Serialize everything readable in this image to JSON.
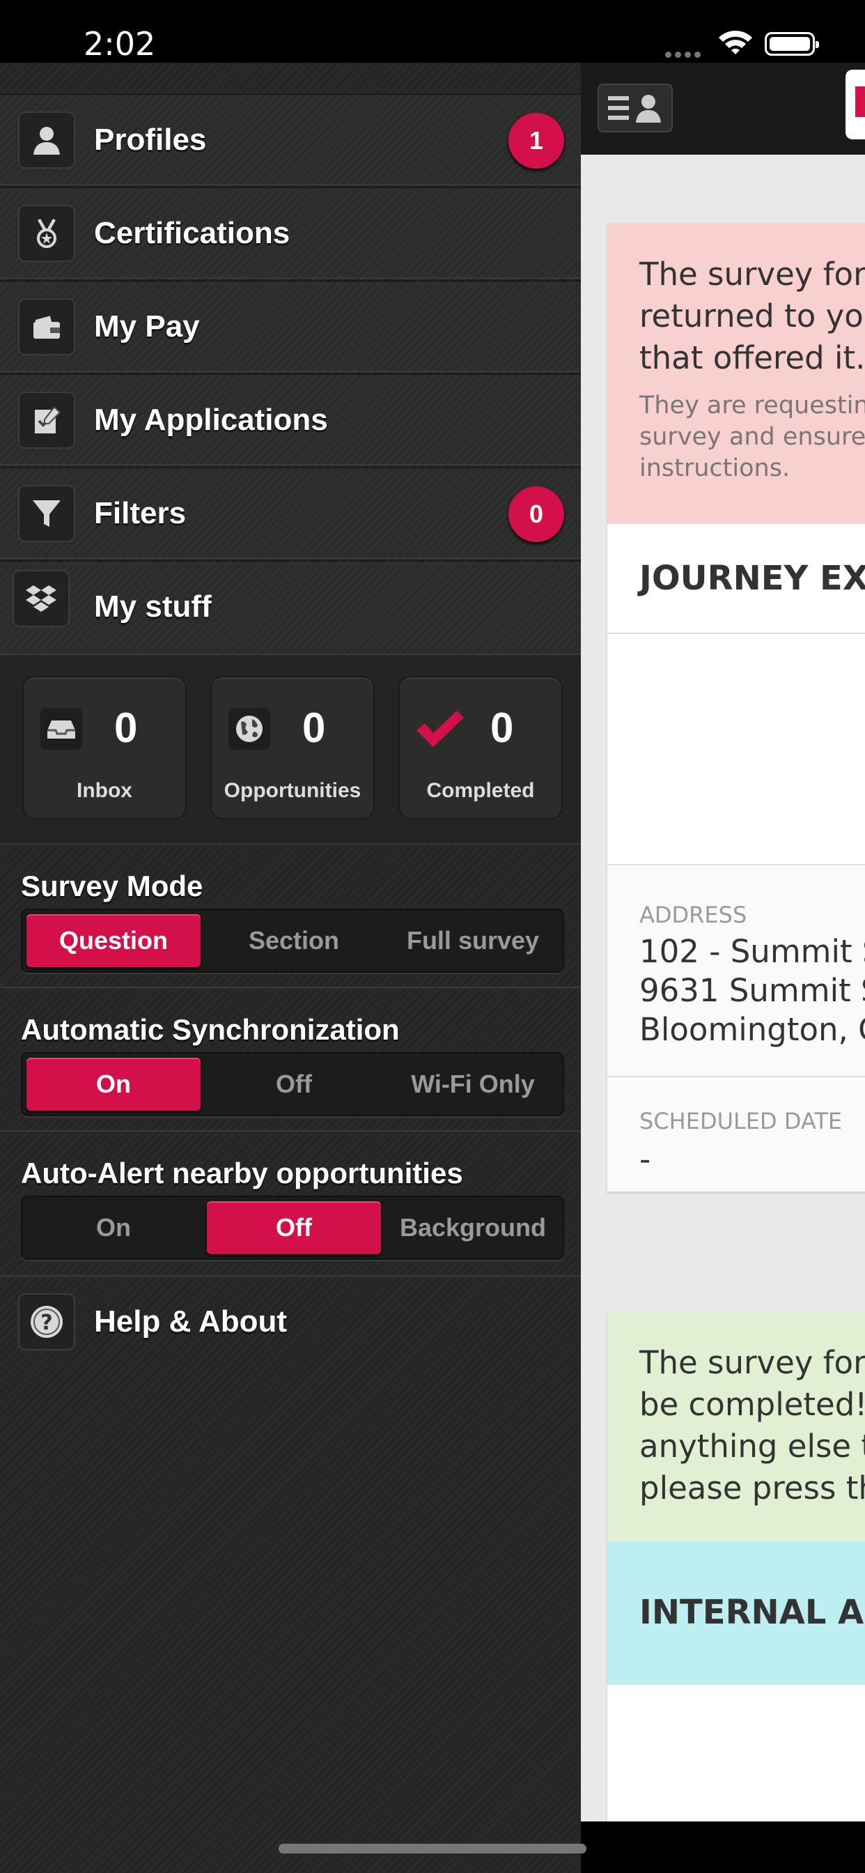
{
  "status_bar": {
    "time": "2:02"
  },
  "sidebar": {
    "items": [
      {
        "label": "Profiles",
        "badge": "1",
        "icon": "person-icon"
      },
      {
        "label": "Certifications",
        "badge": null,
        "icon": "medal-icon"
      },
      {
        "label": "My Pay",
        "badge": null,
        "icon": "wallet-icon"
      },
      {
        "label": "My Applications",
        "badge": null,
        "icon": "application-icon"
      },
      {
        "label": "Filters",
        "badge": "0",
        "icon": "filter-icon"
      },
      {
        "label": "My stuff",
        "badge": null,
        "icon": "dropbox-icon"
      }
    ],
    "stuff": [
      {
        "count": "0",
        "label": "Inbox",
        "icon": "inbox-icon"
      },
      {
        "count": "0",
        "label": "Opportunities",
        "icon": "globe-icon"
      },
      {
        "count": "0",
        "label": "Completed",
        "icon": "checkmark-icon"
      }
    ],
    "survey_mode": {
      "title": "Survey Mode",
      "options": [
        "Question",
        "Section",
        "Full survey"
      ],
      "selected": "Question"
    },
    "auto_sync": {
      "title": "Automatic Synchronization",
      "options": [
        "On",
        "Off",
        "Wi-Fi Only"
      ],
      "selected": "On"
    },
    "auto_alert": {
      "title": "Auto-Alert nearby opportunities",
      "options": [
        "On",
        "Off",
        "Background"
      ],
      "selected": "Off"
    },
    "help": {
      "label": "Help & About",
      "icon": "question-icon"
    }
  },
  "colors": {
    "accent": "#d4104b"
  },
  "content": {
    "card1": {
      "alert_lines": [
        "The survey for",
        "returned to you",
        "that offered it."
      ],
      "alert_sub_lines": [
        "They are requesting",
        "survey and ensure",
        "instructions."
      ],
      "heading": "JOURNEY EXI",
      "address_label": "ADDRESS",
      "address_lines": [
        "102 - Summit S",
        "9631 Summit S",
        "Bloomington, C"
      ],
      "date_label": "SCHEDULED DATE",
      "date_value": "-"
    },
    "card2": {
      "alert_lines": [
        "The survey for",
        "be completed!",
        "anything else t",
        "please press th"
      ],
      "heading": "INTERNAL AU"
    }
  }
}
